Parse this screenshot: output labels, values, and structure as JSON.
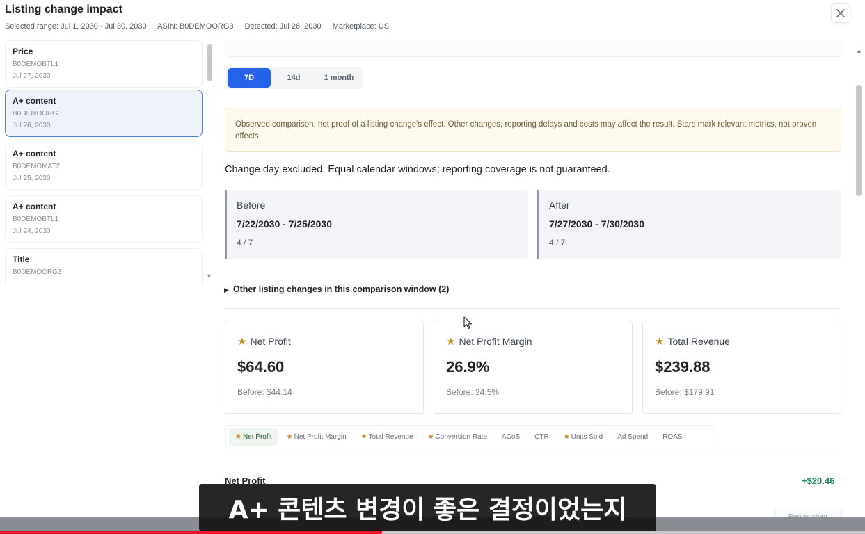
{
  "header": {
    "title": "Listing change impact",
    "meta": [
      "Selected range: Jul 1, 2030 - Jul 30, 2030",
      "ASIN: B0DEMOORG3",
      "Detected: Jul 26, 2030",
      "Marketplace: US"
    ],
    "close_icon": "close-icon"
  },
  "sidebar": {
    "items": [
      {
        "title": "Price",
        "asin": "B0DEMOBTL1",
        "date": "Jul 27, 2030"
      },
      {
        "title": "A+ content",
        "asin": "B0DEMOORG3",
        "date": "Jul 26, 2030"
      },
      {
        "title": "A+ content",
        "asin": "B0DEMOMAT2",
        "date": "Jul 25, 2030"
      },
      {
        "title": "A+ content",
        "asin": "B0DEMOBTL1",
        "date": "Jul 24, 2030"
      },
      {
        "title": "Title",
        "asin": "B0DEMOORG3",
        "date": ""
      }
    ],
    "active_index": 1
  },
  "periods": {
    "options": [
      "7D",
      "14d",
      "1 month"
    ],
    "selected": "7D"
  },
  "notice": "Observed comparison, not proof of a listing change's effect. Other changes, reporting delays and costs may affect the result. Stars mark relevant metrics, not proven effects.",
  "note": "Change day excluded. Equal calendar windows; reporting coverage is not guaranteed.",
  "windows": {
    "before": {
      "label": "Before",
      "range": "7/22/2030 - 7/25/2030",
      "coverage": "4 / 7"
    },
    "after": {
      "label": "After",
      "range": "7/27/2030 - 7/30/2030",
      "coverage": "4 / 7"
    }
  },
  "other_changes": "Other listing changes in this comparison window (2)",
  "metrics": [
    {
      "label": "Net Profit",
      "value": "$64.60",
      "before": "Before: $44.14"
    },
    {
      "label": "Net Profit Margin",
      "value": "26.9%",
      "before": "Before: 24.5%"
    },
    {
      "label": "Total Revenue",
      "value": "$239.88",
      "before": "Before: $179.91"
    }
  ],
  "metric_tabs": [
    {
      "label": "Net Profit",
      "star": true
    },
    {
      "label": "Net Profit Margin",
      "star": true
    },
    {
      "label": "Total Revenue",
      "star": true
    },
    {
      "label": "Conversion Rate",
      "star": true
    },
    {
      "label": "ACoS",
      "star": false
    },
    {
      "label": "CTR",
      "star": false
    },
    {
      "label": "Units Sold",
      "star": true
    },
    {
      "label": "Ad Spend",
      "star": false
    },
    {
      "label": "ROAS",
      "star": false
    }
  ],
  "active_metric_tab": "Net Profit",
  "chart": {
    "title": "Net Profit",
    "delta": "+$20.46",
    "replay_label": "Replay chart"
  },
  "subtitle": "A+ 콘텐츠 변경이 좋은 결정이었는지",
  "video": {
    "progress": 0.4377
  },
  "colors": {
    "accent": "#2563eb",
    "star": "#c28a1b",
    "positive": "#1f8a57",
    "notice_bg": "#fdf9ec"
  }
}
